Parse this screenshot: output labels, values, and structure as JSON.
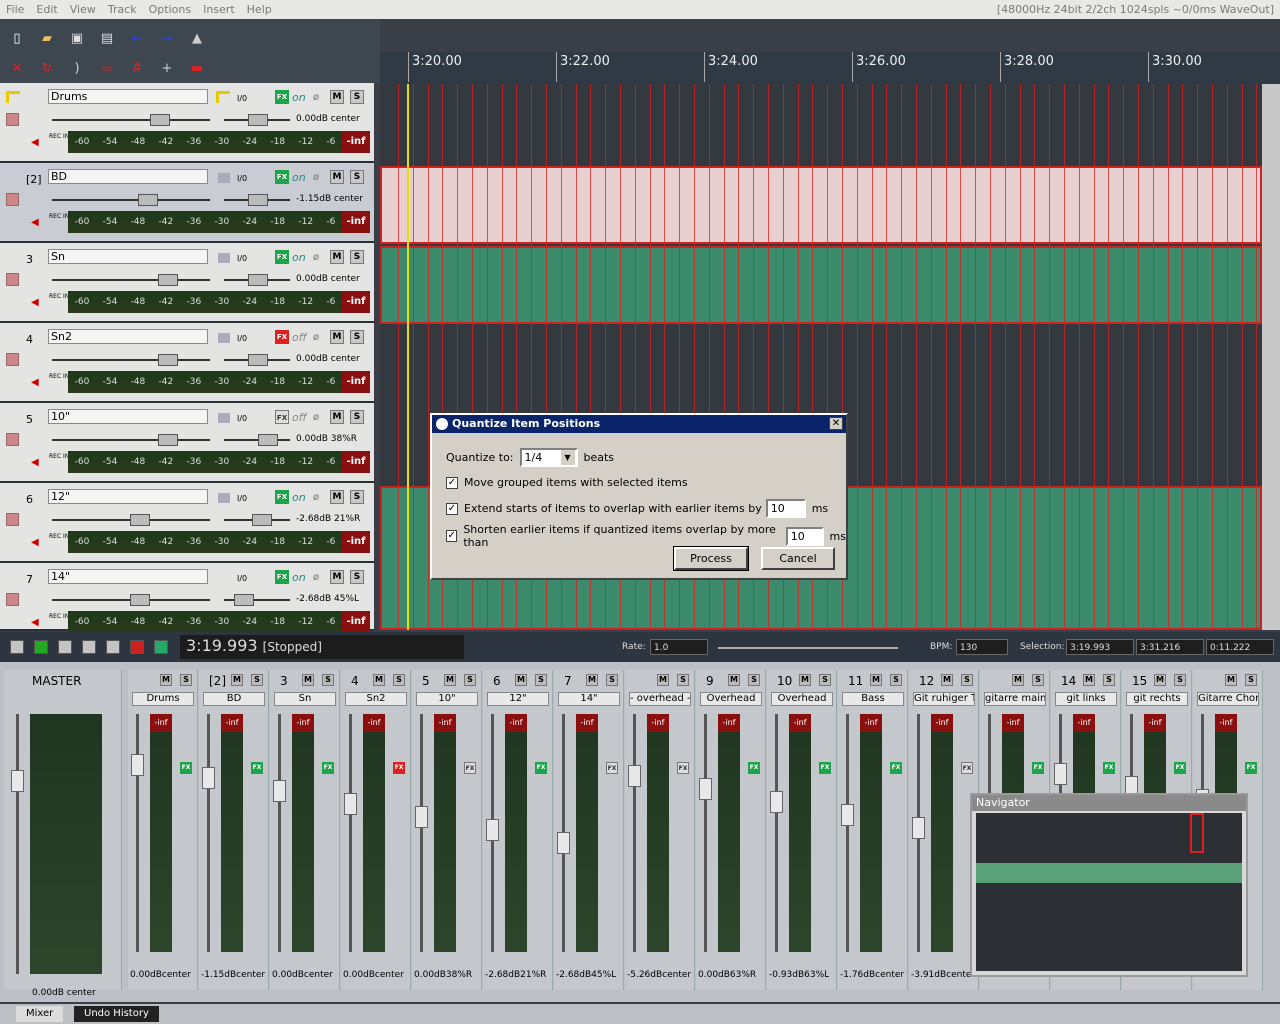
{
  "menu": [
    "File",
    "Edit",
    "View",
    "Track",
    "Options",
    "Insert",
    "Help"
  ],
  "status": "[48000Hz 24bit 2/2ch 1024spls ~0/0ms WaveOut]",
  "ruler": [
    "3:20.00",
    "3:22.00",
    "3:24.00",
    "3:26.00",
    "3:28.00",
    "3:30.00"
  ],
  "meter_scale": [
    "-60",
    "-54",
    "-48",
    "-42",
    "-36",
    "-30",
    "-24",
    "-18",
    "-12",
    "-6"
  ],
  "tracks": [
    {
      "num": "",
      "name": "Drums",
      "vol": "0.00dB center",
      "fx": "on",
      "sel": false,
      "folder": true
    },
    {
      "num": "[2]",
      "name": "BD",
      "vol": "-1.15dB center",
      "fx": "on",
      "sel": true
    },
    {
      "num": "3",
      "name": "Sn",
      "vol": "0.00dB center",
      "fx": "on",
      "sel": false
    },
    {
      "num": "4",
      "name": "Sn2",
      "vol": "0.00dB center",
      "fx": "off",
      "sel": false
    },
    {
      "num": "5",
      "name": "10\"",
      "vol": "0.00dB 38%R",
      "fx": "off",
      "sel": false
    },
    {
      "num": "6",
      "name": "12\"",
      "vol": "-2.68dB 21%R",
      "fx": "on",
      "sel": false
    },
    {
      "num": "7",
      "name": "14\"",
      "vol": "-2.68dB 45%L",
      "fx": "on",
      "sel": false
    }
  ],
  "track_labels": {
    "io": "I/0",
    "fx": "FX",
    "m": "M",
    "s": "S",
    "inf": "-inf",
    "rec": "REC IN"
  },
  "transport": {
    "time": "3:19.993",
    "state": "[Stopped]",
    "rate_label": "Rate:",
    "rate": "1.0",
    "bpm_label": "BPM:",
    "bpm": "130",
    "sel_label": "Selection:",
    "sel_start": "3:19.993",
    "sel_end": "3:31.216",
    "sel_len": "0:11.222"
  },
  "mixer": {
    "master_label": "MASTER",
    "master_vol": "0.00dB center",
    "strips": [
      {
        "num": "",
        "name": "Drums",
        "vol": "0.00dBcenter"
      },
      {
        "num": "[2]",
        "name": "BD",
        "vol": "-1.15dBcenter"
      },
      {
        "num": "3",
        "name": "Sn",
        "vol": "0.00dBcenter"
      },
      {
        "num": "4",
        "name": "Sn2",
        "vol": "0.00dBcenter"
      },
      {
        "num": "5",
        "name": "10\"",
        "vol": "0.00dB38%R"
      },
      {
        "num": "6",
        "name": "12\"",
        "vol": "-2.68dB21%R"
      },
      {
        "num": "7",
        "name": "14\"",
        "vol": "-2.68dB45%L"
      },
      {
        "num": "",
        "name": "- overhead -",
        "vol": "-5.26dBcenter"
      },
      {
        "num": "9",
        "name": "Overhead",
        "vol": "0.00dB63%R"
      },
      {
        "num": "10",
        "name": "Overhead",
        "vol": "-0.93dB63%L"
      },
      {
        "num": "11",
        "name": "Bass",
        "vol": "-1.76dBcenter"
      },
      {
        "num": "12",
        "name": "Git ruhiger Te",
        "vol": "-3.91dBcenter"
      },
      {
        "num": "",
        "name": "gitarre main",
        "vol": ""
      },
      {
        "num": "14",
        "name": "git links",
        "vol": ""
      },
      {
        "num": "15",
        "name": "git rechts",
        "vol": ""
      },
      {
        "num": "",
        "name": "Gitarre Choru",
        "vol": ""
      }
    ]
  },
  "navigator": {
    "title": "Navigator"
  },
  "tabs": [
    "Mixer",
    "Undo History"
  ],
  "dialog": {
    "title": "Quantize Item Positions",
    "quantize_label": "Quantize to:",
    "quantize_value": "1/4",
    "beats": "beats",
    "opt1": "Move grouped items with selected items",
    "opt2": "Extend starts of items to overlap with earlier items by",
    "opt2_value": "10",
    "opt3": "Shorten earlier items if quantized items overlap by more than",
    "opt3_value": "10",
    "ms": "ms",
    "process": "Process",
    "cancel": "Cancel",
    "close": "✕"
  }
}
